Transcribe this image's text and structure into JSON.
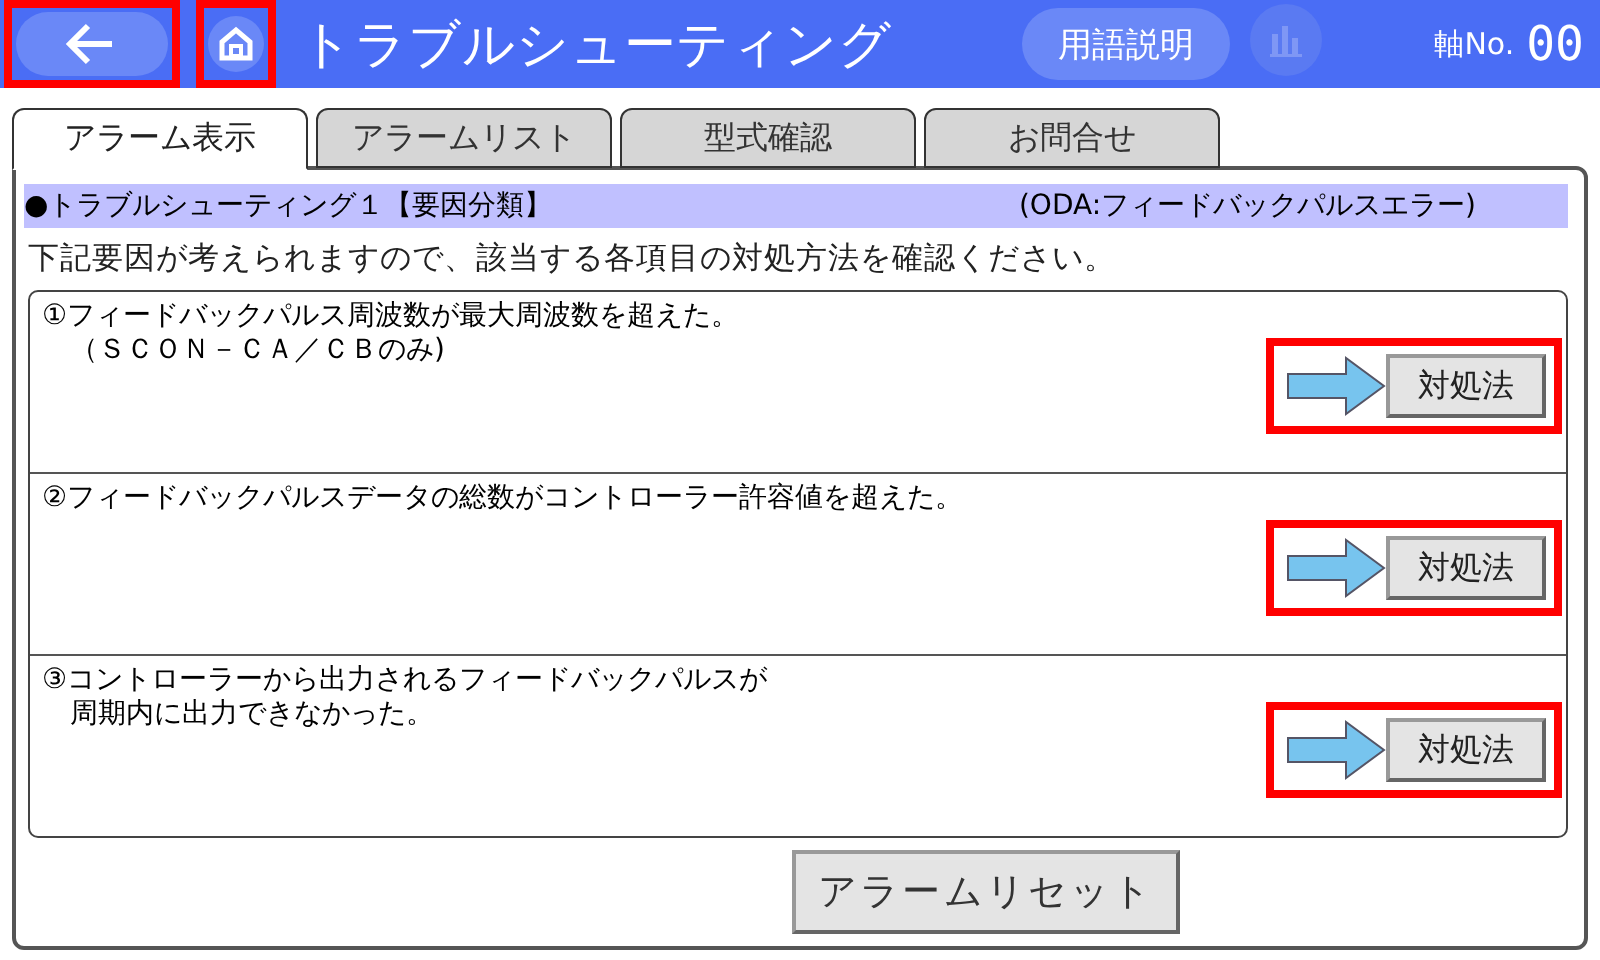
{
  "header": {
    "back_highlighted": true,
    "home_highlighted": true,
    "title": "トラブルシューティング",
    "glossary_button": "用語説明",
    "axis_label": "軸No.",
    "axis_value": "00"
  },
  "tabs": [
    {
      "label": "アラーム表示",
      "selected": true
    },
    {
      "label": "アラームリスト",
      "selected": false
    },
    {
      "label": "型式確認",
      "selected": false
    },
    {
      "label": "お問合せ",
      "selected": false
    }
  ],
  "banner": {
    "title": "●トラブルシューティング１【要因分類】",
    "code": "(ODA:フィードバックパルスエラー)"
  },
  "instruction": "下記要因が考えられますので、該当する各項目の対処方法を確認ください。",
  "causes": [
    {
      "lines": [
        "①フィードバックパルス周波数が最大周波数を超えた。",
        "　（ＳＣＯＮ－ＣＡ／ＣＢのみ)"
      ],
      "button": "対処法",
      "highlighted": true
    },
    {
      "lines": [
        "②フィードバックパルスデータの総数がコントローラー許容値を超えた。"
      ],
      "button": "対処法",
      "highlighted": true
    },
    {
      "lines": [
        "③コントローラーから出力されるフィードバックパルスが",
        "　周期内に出力できなかった。"
      ],
      "button": "対処法",
      "highlighted": true
    }
  ],
  "reset_button": "アラームリセット"
}
